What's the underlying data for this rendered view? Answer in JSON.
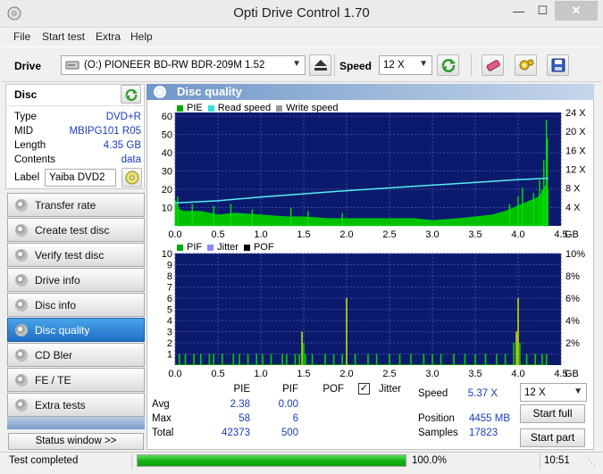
{
  "window": {
    "title": "Opti Drive Control 1.70"
  },
  "menu": [
    "File",
    "Start test",
    "Extra",
    "Help"
  ],
  "drive": {
    "label": "Drive",
    "selected": "(O:)  PIONEER BD-RW   BDR-209M 1.52",
    "speed_label": "Speed",
    "speed_selected": "12 X"
  },
  "disc": {
    "header": "Disc",
    "rows": [
      {
        "key": "Type",
        "value": "DVD+R"
      },
      {
        "key": "MID",
        "value": "MBIPG101 R05"
      },
      {
        "key": "Length",
        "value": "4.35 GB"
      },
      {
        "key": "Contents",
        "value": "data"
      }
    ],
    "label_key": "Label",
    "label_value": "Yaiba DVD2"
  },
  "nav": [
    {
      "label": "Transfer rate",
      "active": false
    },
    {
      "label": "Create test disc",
      "active": false
    },
    {
      "label": "Verify test disc",
      "active": false
    },
    {
      "label": "Drive info",
      "active": false
    },
    {
      "label": "Disc info",
      "active": false
    },
    {
      "label": "Disc quality",
      "active": true
    },
    {
      "label": "CD Bler",
      "active": false
    },
    {
      "label": "FE / TE",
      "active": false
    },
    {
      "label": "Extra tests",
      "active": false
    }
  ],
  "status_window_btn": "Status window >>",
  "panel_title": "Disc quality",
  "chart_data": [
    {
      "type": "line",
      "legend": [
        {
          "name": "PIE",
          "color": "#00aa00"
        },
        {
          "name": "Read speed",
          "color": "#33dddd"
        },
        {
          "name": "Write speed",
          "color": "#999999"
        }
      ],
      "x_ticks": [
        "0.0",
        "0.5",
        "1.0",
        "1.5",
        "2.0",
        "2.5",
        "3.0",
        "3.5",
        "4.0",
        "4.5"
      ],
      "x_unit": "GB",
      "xlim": [
        0,
        4.5
      ],
      "y_ticks": [
        "10",
        "20",
        "30",
        "40",
        "50",
        "60"
      ],
      "ylim": [
        0,
        62
      ],
      "y2_ticks": [
        "4 X",
        "8 X",
        "12 X",
        "16 X",
        "20 X",
        "24 X"
      ],
      "y2lim": [
        0,
        24.8
      ],
      "pie_profile": {
        "x": [
          0.0,
          0.05,
          0.1,
          0.3,
          0.5,
          0.7,
          1.0,
          1.3,
          1.5,
          1.8,
          2.0,
          2.3,
          2.5,
          2.8,
          3.0,
          3.3,
          3.5,
          3.7,
          3.85,
          3.95,
          4.05,
          4.15,
          4.25,
          4.32,
          4.35
        ],
        "y": [
          14,
          9,
          8,
          8,
          6,
          7,
          6,
          5,
          5,
          4,
          4,
          4,
          4,
          4,
          3,
          4,
          5,
          6,
          8,
          10,
          12,
          14,
          16,
          22,
          20
        ]
      },
      "pie_spikes": [
        {
          "x": 0.03,
          "y": 16
        },
        {
          "x": 0.2,
          "y": 12
        },
        {
          "x": 0.45,
          "y": 11
        },
        {
          "x": 0.65,
          "y": 12
        },
        {
          "x": 0.9,
          "y": 9
        },
        {
          "x": 1.35,
          "y": 10
        },
        {
          "x": 1.55,
          "y": 8
        },
        {
          "x": 1.95,
          "y": 7
        },
        {
          "x": 3.9,
          "y": 12
        },
        {
          "x": 4.0,
          "y": 16
        },
        {
          "x": 4.05,
          "y": 21
        },
        {
          "x": 4.18,
          "y": 18
        },
        {
          "x": 4.25,
          "y": 25
        },
        {
          "x": 4.28,
          "y": 20
        },
        {
          "x": 4.3,
          "y": 36
        },
        {
          "x": 4.33,
          "y": 58
        },
        {
          "x": 4.34,
          "y": 48
        }
      ],
      "read_speed": {
        "x": [
          0.0,
          0.5,
          1.0,
          1.5,
          2.0,
          2.5,
          3.0,
          3.5,
          4.0,
          4.35
        ],
        "y": [
          5.0,
          5.5,
          6.3,
          7.0,
          7.7,
          8.3,
          8.9,
          9.5,
          10.1,
          10.4
        ]
      }
    },
    {
      "type": "bar",
      "legend": [
        {
          "name": "PIF",
          "color": "#00aa00"
        },
        {
          "name": "Jitter",
          "color": "#8888ff"
        },
        {
          "name": "POF",
          "color": "#000000"
        }
      ],
      "x_ticks": [
        "0.0",
        "0.5",
        "1.0",
        "1.5",
        "2.0",
        "2.5",
        "3.0",
        "3.5",
        "4.0",
        "4.5"
      ],
      "x_unit": "GB",
      "xlim": [
        0,
        4.5
      ],
      "y_ticks": [
        "1",
        "2",
        "3",
        "4",
        "5",
        "6",
        "7",
        "8",
        "9",
        "10"
      ],
      "ylim": [
        0,
        10
      ],
      "y2_ticks": [
        "2%",
        "4%",
        "6%",
        "8%",
        "10%"
      ],
      "pif": {
        "x": [
          0.05,
          0.12,
          0.22,
          0.3,
          0.4,
          0.45,
          0.55,
          0.68,
          0.75,
          0.85,
          0.95,
          1.02,
          1.12,
          1.25,
          1.3,
          1.4,
          1.45,
          1.48,
          1.5,
          1.52,
          1.6,
          1.75,
          1.85,
          1.95,
          2.0,
          2.1,
          2.25,
          2.35,
          2.5,
          2.62,
          2.75,
          2.9,
          3.0,
          3.1,
          3.25,
          3.38,
          3.5,
          3.62,
          3.75,
          3.85,
          3.95,
          3.98,
          4.0,
          4.02,
          4.1,
          4.2,
          4.28,
          4.33
        ],
        "y": [
          1,
          1,
          1,
          1,
          1,
          1,
          1,
          1,
          1,
          1,
          1,
          1,
          1,
          1,
          1,
          1,
          1,
          3,
          2,
          1,
          1,
          1,
          1,
          1,
          6,
          1,
          1,
          1,
          1,
          1,
          1,
          1,
          1,
          1,
          1,
          1,
          1,
          1,
          1,
          1,
          2,
          3,
          6,
          2,
          1,
          1,
          1,
          1
        ]
      }
    }
  ],
  "stats": {
    "headers": [
      "PIE",
      "PIF",
      "POF",
      "Jitter"
    ],
    "jitter_checked": true,
    "rows": [
      {
        "key": "Avg",
        "pie": "2.38",
        "pif": "0.00"
      },
      {
        "key": "Max",
        "pie": "58",
        "pif": "6"
      },
      {
        "key": "Total",
        "pie": "42373",
        "pif": "500"
      }
    ],
    "speed_label": "Speed",
    "speed_value": "5.37 X",
    "position_label": "Position",
    "position_value": "4455 MB",
    "samples_label": "Samples",
    "samples_value": "17823",
    "speed_combo": "12 X",
    "start_full": "Start full",
    "start_part": "Start part"
  },
  "statusbar": {
    "text": "Test completed",
    "progress": 1.0,
    "progress_text": "100.0%",
    "time": "10:51"
  }
}
